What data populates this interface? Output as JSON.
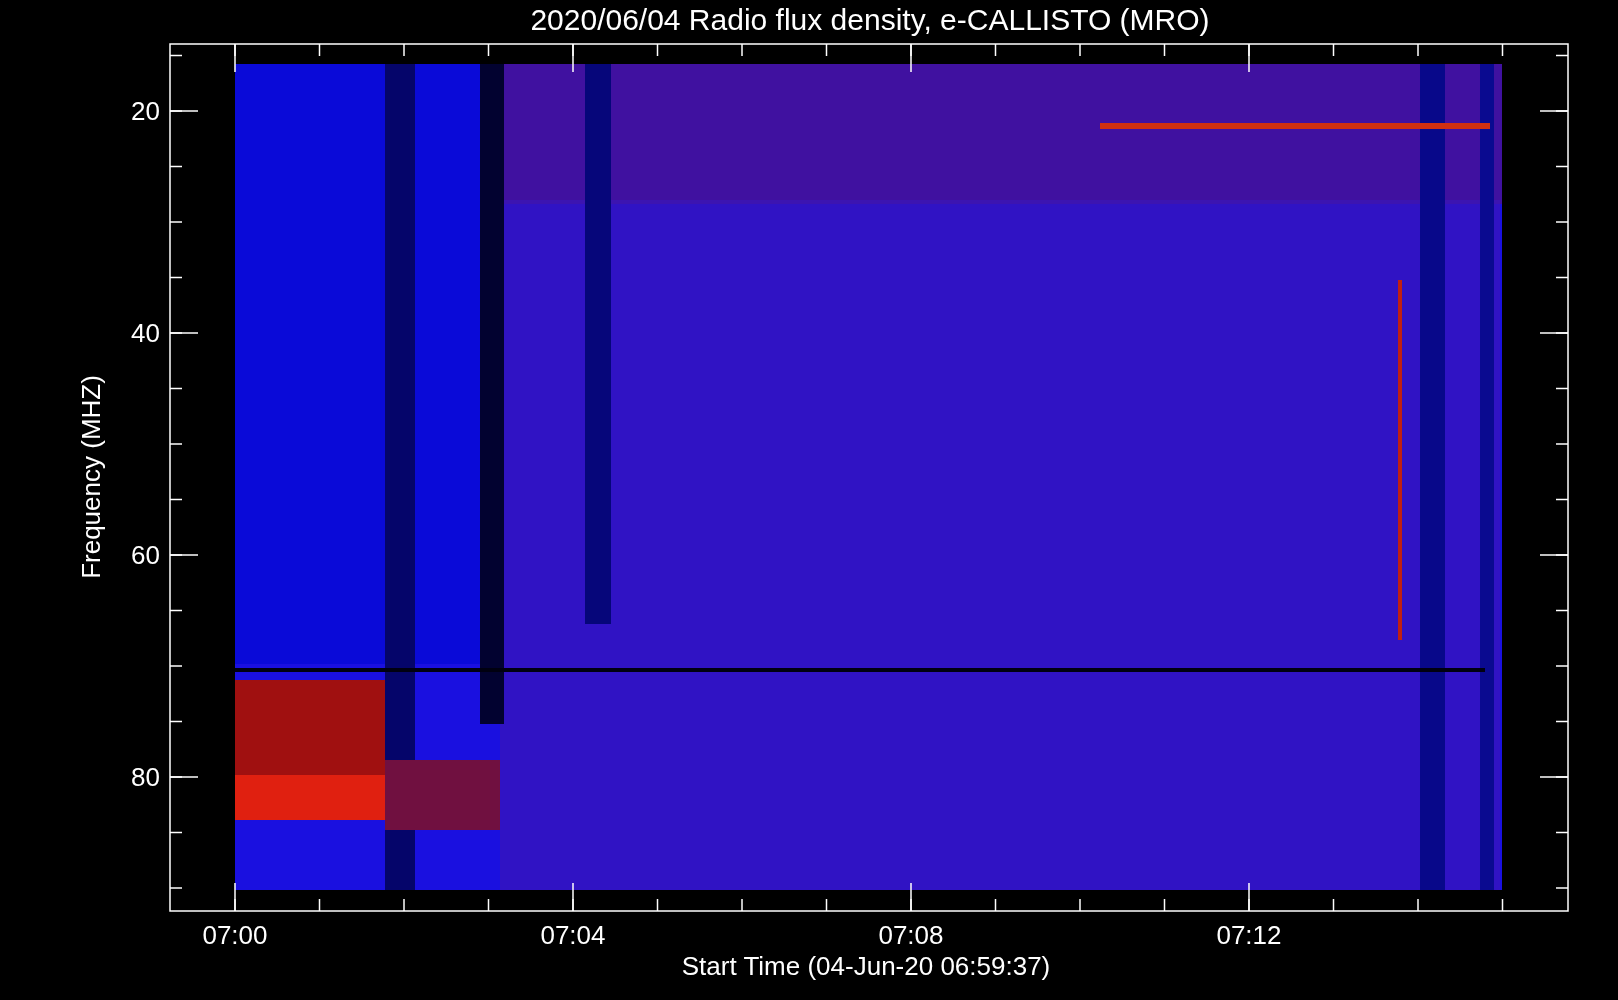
{
  "title": "2020/06/04  Radio flux density, e-CALLISTO (MRO)",
  "y_axis": {
    "label": "Frequency (MHZ)",
    "ticks": [
      "20",
      "40",
      "60",
      "80"
    ]
  },
  "x_axis": {
    "label": "Start Time (04-Jun-20 06:59:37)",
    "ticks": [
      "07:00",
      "07:04",
      "07:08",
      "07:12"
    ]
  }
}
